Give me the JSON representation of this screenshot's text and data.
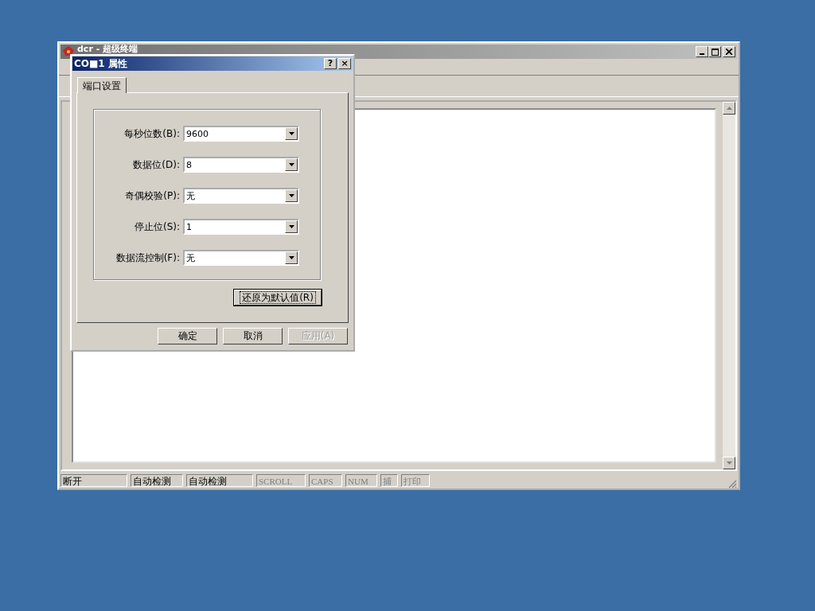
{
  "main_window": {
    "title": "dcr - 超级终端",
    "active": false
  },
  "dialog": {
    "title": "CO■1 属性",
    "help_button": "?",
    "close_button": "×",
    "tabs": [
      {
        "label": "端口设置",
        "selected": true
      }
    ],
    "fields": [
      {
        "label": "每秒位数(B):",
        "value": "9600"
      },
      {
        "label": "数据位(D):",
        "value": "8"
      },
      {
        "label": "奇偶校验(P):",
        "value": "无"
      },
      {
        "label": "停止位(S):",
        "value": "1"
      },
      {
        "label": "数据流控制(F):",
        "value": "无"
      }
    ],
    "restore_button": "还原为默认值(R)",
    "buttons": [
      {
        "label": "确定",
        "disabled": false
      },
      {
        "label": "取消",
        "disabled": false
      },
      {
        "label": "应用(A)",
        "disabled": true
      }
    ]
  },
  "status_bar": [
    {
      "text": "断开",
      "enabled": true
    },
    {
      "text": "自动检测",
      "enabled": true
    },
    {
      "text": "自动检测",
      "enabled": true
    },
    {
      "text": "SCROLL",
      "enabled": false
    },
    {
      "text": "CAPS",
      "enabled": false
    },
    {
      "text": "NUM",
      "enabled": false
    },
    {
      "text": "捕",
      "enabled": false
    },
    {
      "text": "打印",
      "enabled": false
    }
  ]
}
